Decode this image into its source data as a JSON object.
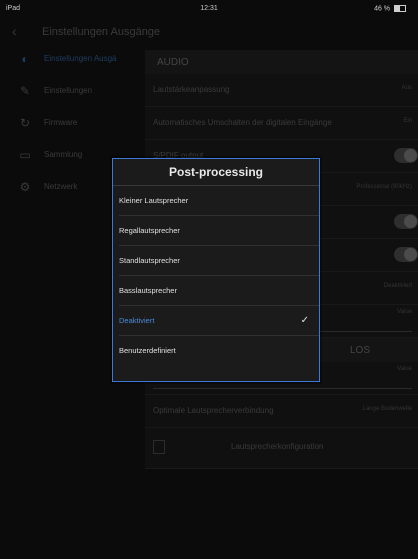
{
  "status": {
    "device": "iPad",
    "time": "12:31",
    "battery": "46 %"
  },
  "nav": {
    "back": "‹",
    "title": "Einstellungen Ausgänge"
  },
  "sidebar": {
    "items": [
      {
        "label": "Einstellungen Ausgä",
        "icon": "speaker-icon"
      },
      {
        "label": "Einstellungen",
        "icon": "wrench-icon"
      },
      {
        "label": "Firmware",
        "icon": "refresh-icon"
      },
      {
        "label": "Sammlung",
        "icon": "folder-icon"
      },
      {
        "label": "Netzwerk",
        "icon": "gear-icon"
      }
    ]
  },
  "content": {
    "section": "AUDIO",
    "rows": [
      {
        "label": "Lautstärkeanpassung",
        "value": "Aus"
      },
      {
        "label": "Automatisches Umschalten der digitalen Eingänge",
        "value": "Ein"
      },
      {
        "label": "S/PDIF output",
        "value": ""
      },
      {
        "label": "",
        "value": "Professional (90kHz)"
      },
      {
        "label": "",
        "value": ""
      },
      {
        "label": "",
        "value": ""
      },
      {
        "label": "",
        "value": "Deaktiviert"
      },
      {
        "label": "",
        "value": "Value"
      },
      {
        "label": "",
        "value": ""
      },
      {
        "label": "",
        "value": "Value"
      },
      {
        "label": "Optimale Lautsprecherverbindung",
        "value": "Lange Bodenwelle"
      },
      {
        "label": "Lautsprecherkonfiguration",
        "value": ""
      }
    ],
    "sub_section": "LOS"
  },
  "modal": {
    "title": "Post-processing",
    "options": [
      {
        "label": "Kleiner Lautsprecher",
        "selected": false
      },
      {
        "label": "Regallautsprecher",
        "selected": false
      },
      {
        "label": "Standlautsprecher",
        "selected": false
      },
      {
        "label": "Basslautsprecher",
        "selected": false
      },
      {
        "label": "Deaktiviert",
        "selected": true
      },
      {
        "label": "Benutzerdefiniert",
        "selected": false
      }
    ],
    "check_glyph": "✓",
    "accent": "#3c78d8"
  }
}
